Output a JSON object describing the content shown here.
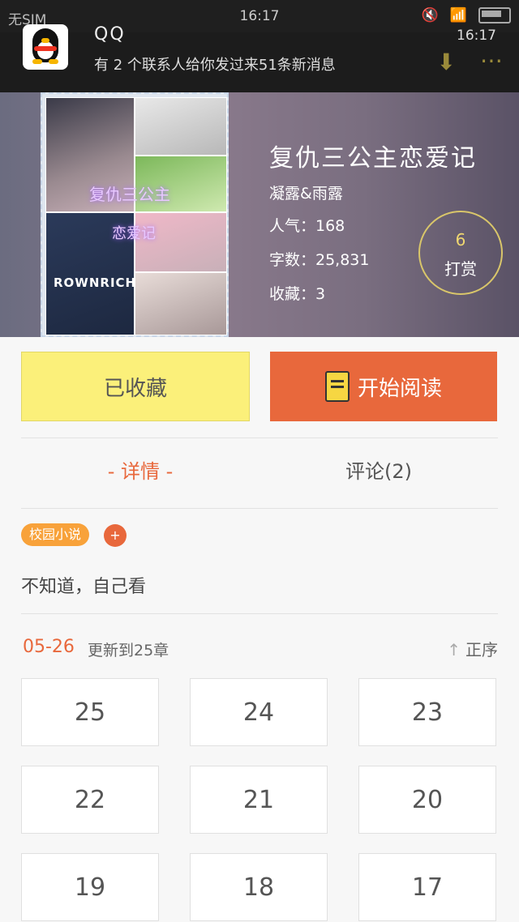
{
  "status_bar": {
    "carrier": "无SIM",
    "time": "16:17"
  },
  "notification": {
    "app_name": "QQ",
    "time": "16:17",
    "message": "有 2 个联系人给你发过来51条新消息"
  },
  "book": {
    "cover_title_line1": "复仇三公主",
    "cover_title_line2": "恋爱记",
    "cover_brand": "ROWNRICH",
    "title": "复仇三公主恋爱记",
    "author": "凝露&雨露",
    "popularity": "人气：168",
    "word_count": "字数：25,831",
    "favorites": "收藏：3",
    "tip_count": "6",
    "tip_label": "打赏"
  },
  "actions": {
    "favorite_label": "已收藏",
    "read_label": "开始阅读"
  },
  "tabs": {
    "detail": "- 详情 -",
    "comments": "评论(2)"
  },
  "tag": {
    "label": "校园小说",
    "add": "+"
  },
  "description": "不知道，自己看",
  "update": {
    "date": "05-26",
    "text": "更新到25章",
    "sort_label": "正序",
    "sort_arrow": "↑"
  },
  "chapters": [
    "25",
    "24",
    "23",
    "22",
    "21",
    "20",
    "19",
    "18",
    "17"
  ],
  "colors": {
    "accent": "#e8683c",
    "favorite_bg": "#fbf07a",
    "tag_bg": "#f8a23a"
  }
}
